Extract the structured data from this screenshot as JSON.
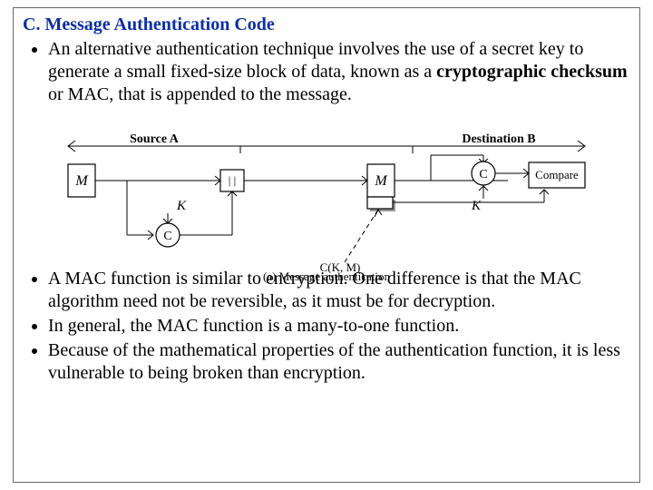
{
  "heading": "C. Message Authentication Code",
  "bullets_top": [
    "An alternative authentication technique involves the use of a secret key to generate a small fixed-size block of data, known as a cryptographic checksum or MAC, that is appended to the message."
  ],
  "bullets_bottom": [
    "A MAC function is similar to encryption. One difference is that the MAC algorithm need not be reversible, as it must be for decryption.",
    "In general, the MAC function is a many-to-one function.",
    "Because of the mathematical properties of the authentication function, it is less vulnerable to being broken than encryption."
  ],
  "rich_top": {
    "pre": "An alternative authentication technique involves the use of a secret key to generate a small fixed-size block of data, known as a ",
    "bold": "cryptographic checksum",
    "post": " or MAC, that is appended to the message."
  },
  "fig": {
    "source_label": "Source A",
    "dest_label": "Destination B",
    "M": "M",
    "K": "K",
    "C": "C",
    "doublepipe": "| |",
    "compare": "Compare",
    "mac_label": "C(K, M)",
    "caption": "(a) Message authentication"
  }
}
